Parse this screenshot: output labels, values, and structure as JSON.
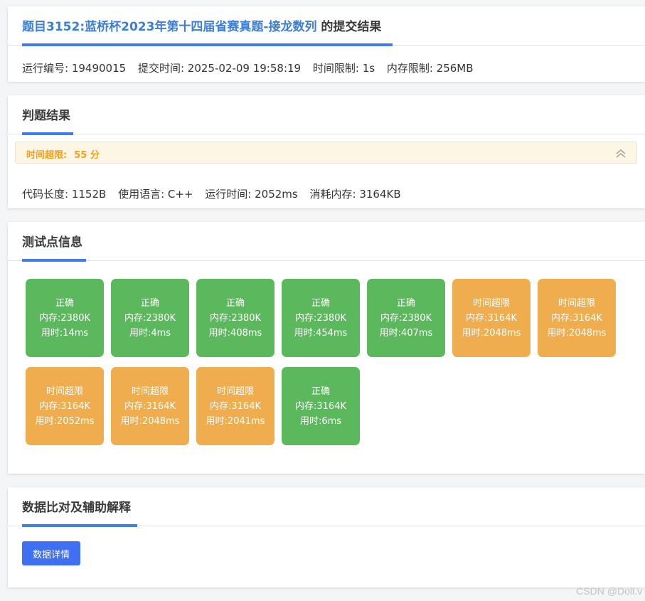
{
  "header": {
    "problem_link": "题目3152:蓝桥杯2023年第十四届省赛真题-接龙数列",
    "title_suffix": " 的提交结果",
    "meta": [
      "运行编号: 19490015",
      "提交时间: 2025-02-09 19:58:19",
      "时间限制: 1s",
      "内存限制: 256MB"
    ]
  },
  "judge": {
    "title": "判题结果",
    "verdict_label": "时间超限:",
    "score": "55 分",
    "stats": [
      "代码长度: 1152B",
      "使用语言: C++",
      "运行时间: 2052ms",
      "消耗内存: 3164KB"
    ]
  },
  "tests": {
    "title": "测试点信息",
    "items": [
      {
        "status": "正确",
        "mem": "内存:2380K",
        "time": "用时:14ms",
        "kind": "ok"
      },
      {
        "status": "正确",
        "mem": "内存:2380K",
        "time": "用时:4ms",
        "kind": "ok"
      },
      {
        "status": "正确",
        "mem": "内存:2380K",
        "time": "用时:408ms",
        "kind": "ok"
      },
      {
        "status": "正确",
        "mem": "内存:2380K",
        "time": "用时:454ms",
        "kind": "ok"
      },
      {
        "status": "正确",
        "mem": "内存:2380K",
        "time": "用时:407ms",
        "kind": "ok"
      },
      {
        "status": "时间超限",
        "mem": "内存:3164K",
        "time": "用时:2048ms",
        "kind": "tle"
      },
      {
        "status": "时间超限",
        "mem": "内存:3164K",
        "time": "用时:2048ms",
        "kind": "tle"
      },
      {
        "status": "时间超限",
        "mem": "内存:3164K",
        "time": "用时:2052ms",
        "kind": "tle"
      },
      {
        "status": "时间超限",
        "mem": "内存:3164K",
        "time": "用时:2048ms",
        "kind": "tle"
      },
      {
        "status": "时间超限",
        "mem": "内存:3164K",
        "time": "用时:2041ms",
        "kind": "tle"
      },
      {
        "status": "正确",
        "mem": "内存:3164K",
        "time": "用时:6ms",
        "kind": "ok"
      }
    ]
  },
  "compare": {
    "title": "数据比对及辅助解释",
    "button_label": "数据详情"
  },
  "watermark": "CSDN @Doll.v",
  "colors": {
    "accent": "#3f7cf0",
    "ok": "#5cb85c",
    "tle": "#f0ad4e",
    "verdict_text": "#f0a020",
    "link": "#3b7ed3"
  },
  "icons": {
    "collapse": "double-chevron-up-icon"
  }
}
